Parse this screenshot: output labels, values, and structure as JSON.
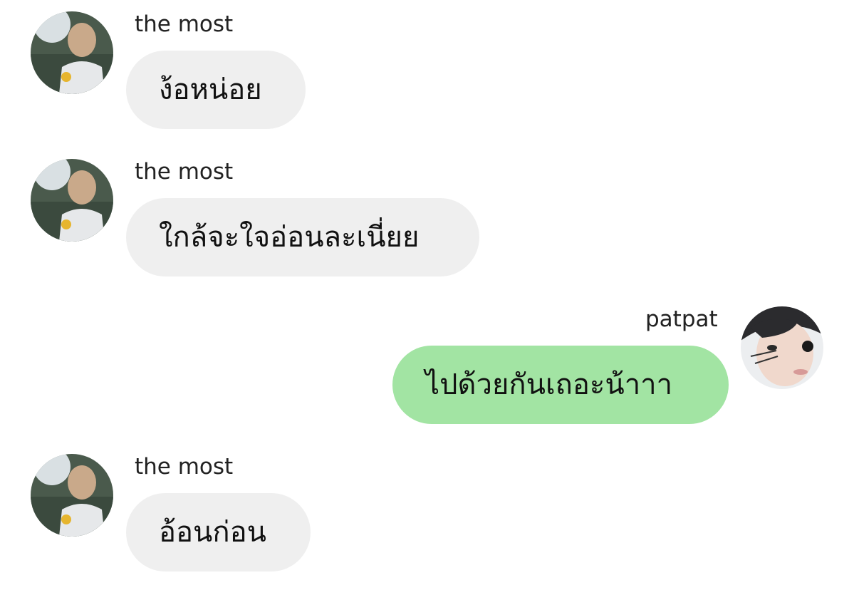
{
  "messages": [
    {
      "sender": "the most",
      "text": "ง้อหน่อย",
      "direction": "incoming"
    },
    {
      "sender": "the most",
      "text": "ใกล้จะใจอ่อนละเนี่ยย",
      "direction": "incoming"
    },
    {
      "sender": "patpat",
      "text": "ไปด้วยกันเถอะน้าาา",
      "direction": "outgoing"
    },
    {
      "sender": "the most",
      "text": "อ้อนก่อน",
      "direction": "incoming"
    }
  ],
  "colors": {
    "incoming_bubble": "#efefef",
    "outgoing_bubble": "#a2e4a3",
    "background": "#ffffff"
  },
  "icons": {
    "incoming_avatar": "user-photo-avatar",
    "outgoing_avatar": "user-photo-avatar"
  }
}
